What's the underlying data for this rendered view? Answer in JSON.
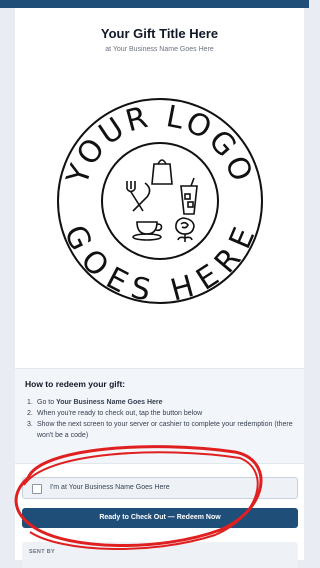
{
  "header": {
    "title": "Your Gift Title Here",
    "subtitle": "at Your Business Name Goes Here"
  },
  "logo": {
    "top_text": "YOUR LOGO",
    "bottom_text": "GOES HERE",
    "icons": [
      "bag-icon",
      "cutlery-icon",
      "iced-drink-icon",
      "coffee-cup-icon",
      "rose-icon"
    ]
  },
  "redeem": {
    "heading": "How to redeem your gift:",
    "steps": [
      {
        "num": "1.",
        "prefix": "Go to ",
        "bold": "Your Business Name Goes Here",
        "suffix": ""
      },
      {
        "num": "2.",
        "prefix": "When you're ready to check out, tap the button below",
        "bold": "",
        "suffix": ""
      },
      {
        "num": "3.",
        "prefix": "Show the next screen to your server or cashier to complete your redemption (there won't be a code)",
        "bold": "",
        "suffix": ""
      }
    ]
  },
  "checkbox": {
    "label": "I'm at Your Business Name Goes Here",
    "checked": false
  },
  "cta": {
    "label": "Ready to Check Out — Redeem Now"
  },
  "sent_by": {
    "label": "SENT BY"
  },
  "colors": {
    "brand": "#1f4e79",
    "annotation": "#e02020"
  }
}
